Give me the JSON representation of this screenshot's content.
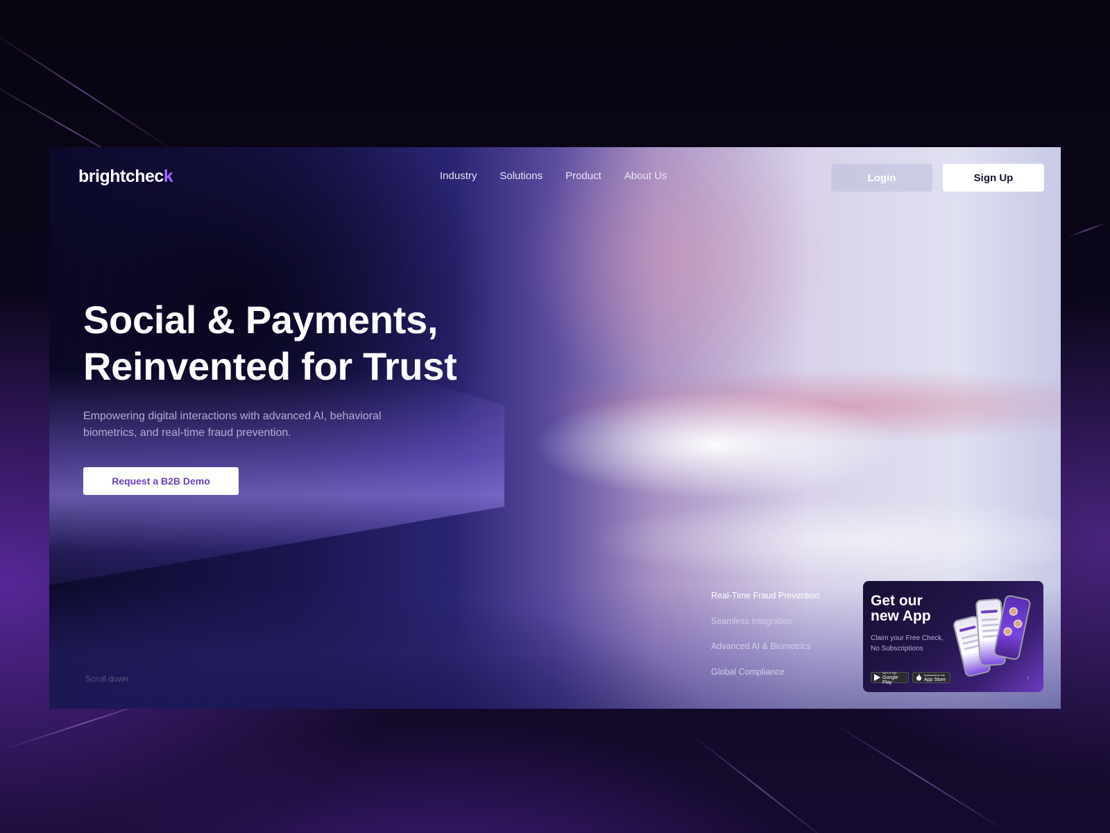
{
  "brand": {
    "logo_main": "brightchec",
    "logo_accent": "k"
  },
  "nav": {
    "items": [
      {
        "label": "Industry"
      },
      {
        "label": "Solutions"
      },
      {
        "label": "Product"
      },
      {
        "label": "About Us"
      }
    ],
    "login_label": "Login",
    "signup_label": "Sign Up"
  },
  "hero": {
    "title_line1": "Social & Payments,",
    "title_line2": "Reinvented for Trust",
    "subtitle": "Empowering digital interactions with advanced AI, behavioral biometrics, and real-time fraud prevention.",
    "cta_label": "Request a B2B Demo"
  },
  "scroll_hint": "Scroll down",
  "features": {
    "items": [
      {
        "label": "Real-Time Fraud Prevention",
        "active": true
      },
      {
        "label": "Seamless Integration",
        "active": false
      },
      {
        "label": "Advanced AI & Biometrics",
        "active": false
      },
      {
        "label": "Global Compliance",
        "active": false
      }
    ]
  },
  "app_promo": {
    "title_line1": "Get our",
    "title_line2": "new App",
    "subtitle": "Claim your Free Check, No Subscriptions",
    "google_play_small": "GET IT ON",
    "google_play_label": "Google Play",
    "app_store_small": "Download on the",
    "app_store_label": "App Store",
    "arrow_icon": "chevron-right-icon"
  },
  "colors": {
    "accent": "#a06bff",
    "cta_text": "#6a3ec2",
    "signup_text": "#1a1430"
  }
}
